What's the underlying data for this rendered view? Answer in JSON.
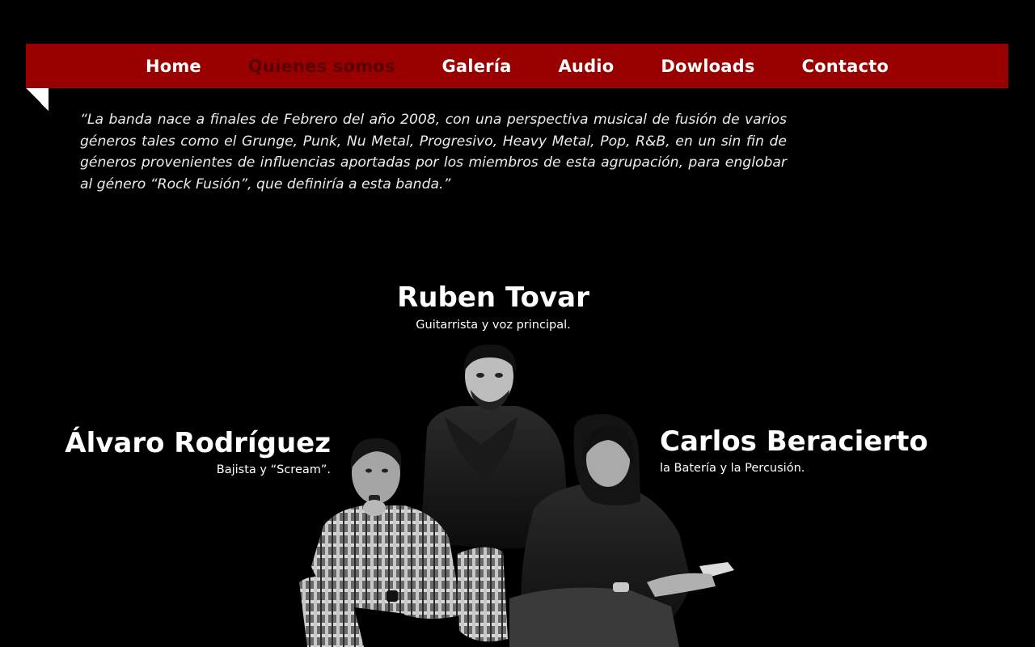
{
  "nav": {
    "items": [
      {
        "label": "Home",
        "active": false
      },
      {
        "label": "Quienes somos",
        "active": true
      },
      {
        "label": "Galería",
        "active": false
      },
      {
        "label": "Audio",
        "active": false
      },
      {
        "label": "Dowloads",
        "active": false
      },
      {
        "label": "Contacto",
        "active": false
      }
    ]
  },
  "intro": {
    "text": "“La banda nace a finales de Febrero del año 2008, con una perspectiva musical de fusión de varios géneros tales como el Grunge, Punk, Nu Metal, Progresivo, Heavy Metal, Pop, R&B, en un sin fin de géneros provenientes de influencias aportadas por los miembros de esta agrupación, para englobar al género “Rock Fusión”, que definiría a esta banda.”"
  },
  "members": {
    "center": {
      "name": "Ruben Tovar",
      "role": "Guitarrista y voz principal."
    },
    "left": {
      "name": "Álvaro Rodríguez",
      "role": "Bajista y “Scream”."
    },
    "right": {
      "name": "Carlos Beracierto",
      "role": "la Batería y la Percusión."
    }
  },
  "colors": {
    "background": "#000000",
    "nav_bar": "#990000",
    "nav_active": "#5a0000",
    "text": "#ffffff"
  }
}
